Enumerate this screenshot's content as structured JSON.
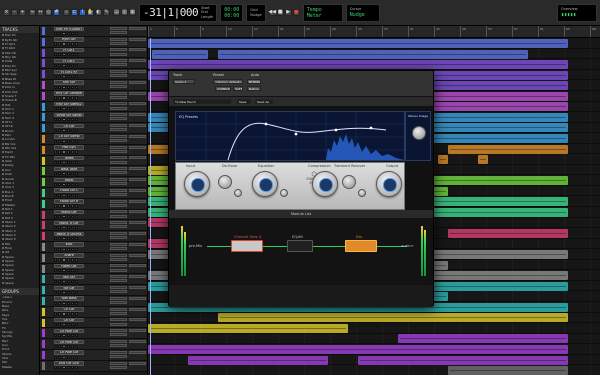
{
  "transport": {
    "counter": "-31|1|000",
    "counter_sub": "▸",
    "labels": [
      "Grid",
      "Nudge",
      "Start",
      "End",
      "Length",
      "Cursor"
    ],
    "lcd": [
      "00:00",
      "00:00",
      "Nudge"
    ],
    "right_lcd": [
      "Tempo",
      "Meter",
      "Overview"
    ]
  },
  "sidebar": {
    "tracks_title": "TRACKS",
    "tracks": [
      "Elec Pn",
      "Ryth Gtr",
      "FI Gtr1",
      "FI Gtr2",
      "Shk Gtr",
      "Rhy Gtr",
      "Slide",
      "Elec Pn",
      "Pad Syn",
      "Str Swp",
      "Bass DI",
      "Bass Amp",
      "Kick In",
      "Kick Out",
      "Snare T",
      "Snare B",
      "Hat",
      "Tom 1",
      "Tom 2",
      "Tom 3",
      "OH L",
      "OH R",
      "Room",
      "Perc",
      "Ld Vox",
      "BG Vox",
      "Dbl Vox",
      "Harm",
      "FX Rtn",
      "Verb",
      "Delay",
      "Aux",
      "Click",
      "Guide",
      "VCA 1",
      "VCA 2",
      "Bus A",
      "Bus B",
      "Print",
      "Master",
      "Ref 1",
      "Ref 2",
      "Ref 3",
      "Stem 1",
      "Stem 2",
      "Stem 3",
      "Stem 4",
      "Stem 5",
      "Mix",
      "Final",
      "Alt",
      "Spare",
      "Spare",
      "Spare",
      "Spare",
      "Spare",
      "Spare",
      "Spare"
    ],
    "groups_title": "GROUPS",
    "groups": [
      "<ALL>",
      "Drums",
      "Bass",
      "Gtrs",
      "Keys",
      "Vox",
      "BGV",
      "FX",
      "Strings",
      "Synths",
      "Perc",
      "Aux",
      "Print",
      "Stems",
      "VCA",
      "Mix",
      "Master"
    ]
  },
  "headers": {
    "top_label": "Elec Pn (Guitar)",
    "tracks": [
      {
        "name": "Elec Pn (Guitar)",
        "color": "#5a6fd6"
      },
      {
        "name": "Ryth Gtr",
        "color": "#5a6fd6"
      },
      {
        "name": "FI Gtr1",
        "color": "#7a4fd0"
      },
      {
        "name": "FI Gtr2",
        "color": "#7a4fd0"
      },
      {
        "name": "FI Gtr1 Rf",
        "color": "#7a4fd0"
      },
      {
        "name": "Shk Gtr",
        "color": "#b04fc8"
      },
      {
        "name": "Rhy Gtr Sample",
        "color": "#b04fc8"
      },
      {
        "name": "Rhy Gtr Samp2",
        "color": "#3a9bd5"
      },
      {
        "name": "Vintg Gtr Samp",
        "color": "#3a9bd5"
      },
      {
        "name": "Ch Gtr",
        "color": "#3a9bd5"
      },
      {
        "name": "Ch Gtr Samp",
        "color": "#d48a2a"
      },
      {
        "name": "Pad Syn",
        "color": "#d48a2a"
      },
      {
        "name": "Tones",
        "color": "#d4c42a"
      },
      {
        "name": "Bass Tone",
        "color": "#6fcf3f"
      },
      {
        "name": "Vocal",
        "color": "#6fcf3f"
      },
      {
        "name": "Flood Gtr L",
        "color": "#3fcf8a"
      },
      {
        "name": "Flood Gtr R",
        "color": "#3fcf8a"
      },
      {
        "name": "Mono Gtr",
        "color": "#cf3f6f"
      },
      {
        "name": "Mono Tr Gtr",
        "color": "#cf3f6f"
      },
      {
        "name": "Mono Tr Drums",
        "color": "#cf3f6f"
      },
      {
        "name": "Kick",
        "color": "#8a8a8a"
      },
      {
        "name": "Snare",
        "color": "#8a8a8a"
      },
      {
        "name": "Harm Gtr",
        "color": "#8a8a8a"
      },
      {
        "name": "Vox Gtr",
        "color": "#2fb3b3"
      },
      {
        "name": "Str Gtr",
        "color": "#2fb3b3"
      },
      {
        "name": "Slat Bass",
        "color": "#2fb3b3"
      },
      {
        "name": "Ch Gtr",
        "color": "#d4c42a"
      },
      {
        "name": "Ch Gtr",
        "color": "#d4c42a"
      },
      {
        "name": "Ch Pole Gtr",
        "color": "#9b3fcf"
      },
      {
        "name": "Ch Pole Gtr",
        "color": "#9b3fcf"
      },
      {
        "name": "Ch Pole Gtr",
        "color": "#9b3fcf"
      },
      {
        "name": "End Gtr Lick",
        "color": "#6f6f6f"
      }
    ]
  },
  "ruler": {
    "marks": [
      "1",
      "5",
      "9",
      "13",
      "17",
      "21",
      "25",
      "29",
      "33",
      "37",
      "41",
      "45",
      "49",
      "53",
      "57",
      "61",
      "65",
      "69"
    ]
  },
  "plugin": {
    "track_label": "Track",
    "preset_label": "Preset",
    "auto_label": "Auto",
    "track_value": "Audio 1",
    "preset_value": "<factory default>",
    "bypass": "BYPASS",
    "compare": "COMPARE",
    "safe": "SAFE",
    "native": "Native",
    "preset_name": "*A New Touch",
    "save": "Save",
    "save_as": "Save As",
    "eq_presets": "EQ Presets",
    "channel_strip": {
      "title": "CHANNEL STRIP",
      "sections": [
        "Input",
        "De-Esser",
        "Equalizer",
        "Compression",
        "Transient Recover",
        "Output"
      ],
      "module_list": "Module List",
      "modules": [
        "Channel Strip 4",
        "EQ/dB",
        "Drv"
      ],
      "stereo_label": "Stereo Image",
      "left_label": "pre-Mix",
      "output_label": "OUTPUT"
    }
  }
}
